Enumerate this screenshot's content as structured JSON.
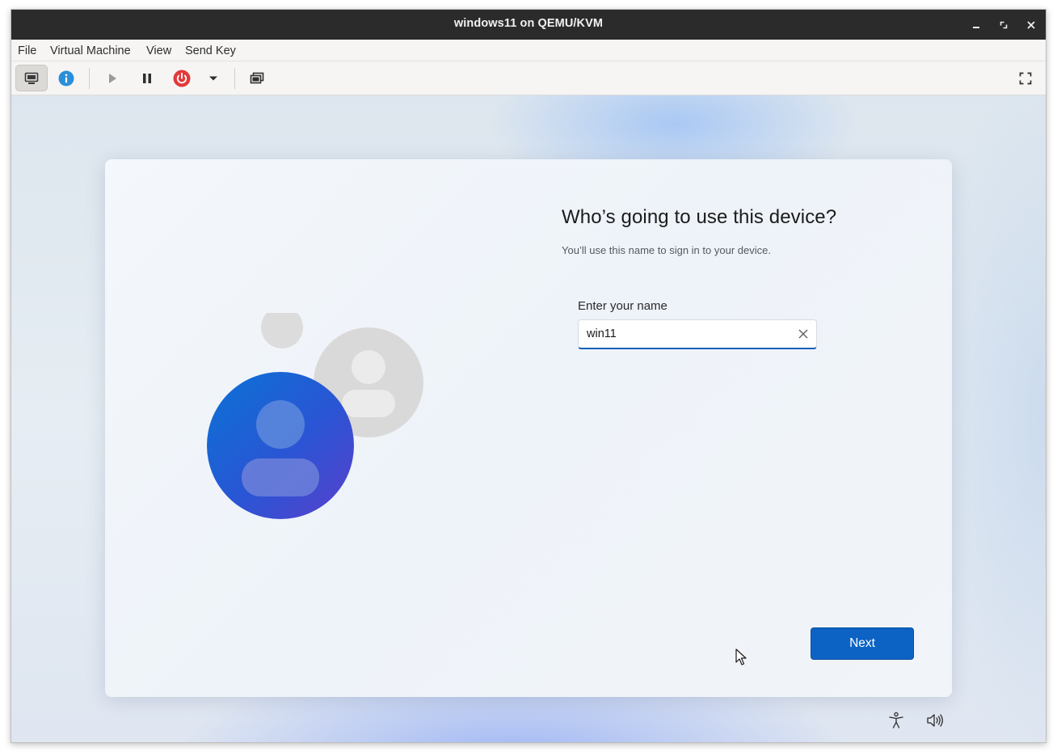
{
  "window": {
    "title": "windows11 on QEMU/KVM",
    "controls": {
      "minimize": "minimize-icon",
      "maximize": "maximize-icon",
      "close": "close-icon"
    }
  },
  "menubar": {
    "items": [
      "File",
      "Virtual Machine",
      "View",
      "Send Key"
    ]
  },
  "toolbar": {
    "buttons": [
      "console-icon",
      "details-info-icon",
      "run-icon",
      "pause-icon",
      "shutdown-icon",
      "shutdown-menu-chevron-icon",
      "snapshots-icon",
      "fullscreen-icon"
    ],
    "active": "console-icon",
    "colors": {
      "info": "#2a8fd8",
      "shutdown": "#e2393a"
    }
  },
  "guest": {
    "heading": "Who’s going to use this device?",
    "subtext": "You’ll use this name to sign in to your device.",
    "name_field": {
      "label": "Enter your name",
      "value": "win11"
    },
    "next_label": "Next",
    "footer_icons": [
      "accessibility-icon",
      "volume-icon"
    ],
    "colors": {
      "accent": "#0c63c4",
      "avatar_blue": "#1f6fd6",
      "avatar_purple": "#5a3fcc"
    }
  }
}
